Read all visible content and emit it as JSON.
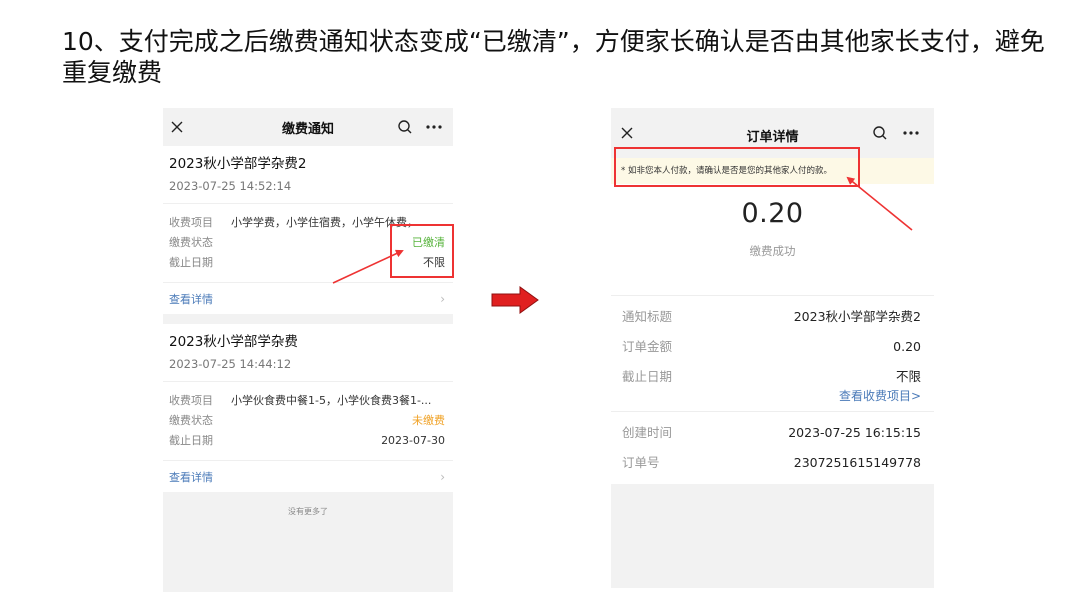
{
  "slide": {
    "title": "10、支付完成之后缴费通知状态变成“已缴清”，方便家长确认是否由其他家长支付，避免重复缴费"
  },
  "left_phone": {
    "nav": {
      "title": "缴费通知",
      "close_icon": "close-icon",
      "search_icon": "search-icon",
      "more_icon": "more-icon"
    },
    "cards": [
      {
        "name": "2023秋小学部学杂费2",
        "time": "2023-07-25 14:52:14",
        "item_label": "收费项目",
        "item_value": "小学学费，小学住宿费，小学午休费，",
        "status_label": "缴费状态",
        "status_value": "已缴清",
        "deadline_label": "截止日期",
        "deadline_value": "不限",
        "detail_link": "查看详情"
      },
      {
        "name": "2023秋小学部学杂费",
        "time": "2023-07-25 14:44:12",
        "item_label": "收费项目",
        "item_value": "小学伙食费中餐1-5，小学伙食费3餐1-...",
        "status_label": "缴费状态",
        "status_value": "未缴费",
        "deadline_label": "截止日期",
        "deadline_value": "2023-07-30",
        "detail_link": "查看详情"
      }
    ],
    "footer": "没有更多了"
  },
  "right_phone": {
    "nav": {
      "title": "订单详情",
      "close_icon": "close-icon",
      "search_icon": "search-icon",
      "more_icon": "more-icon"
    },
    "notice": "* 如非您本人付款，请确认是否是您的其他家人付的款。",
    "amount": "0.20",
    "pay_status": "缴费成功",
    "info": [
      {
        "label": "通知标题",
        "value": "2023秋小学部学杂费2"
      },
      {
        "label": "订单金额",
        "value": "0.20"
      },
      {
        "label": "截止日期",
        "value": "不限"
      }
    ],
    "view_items_link": "查看收费项目>",
    "info2": [
      {
        "label": "创建时间",
        "value": "2023-07-25 16:15:15"
      },
      {
        "label": "订单号",
        "value": "2307251615149778"
      }
    ]
  },
  "colors": {
    "paid": "#56b33b",
    "unpaid": "#f0a226",
    "link": "#4a7ab8",
    "annotation": "#e33333"
  }
}
